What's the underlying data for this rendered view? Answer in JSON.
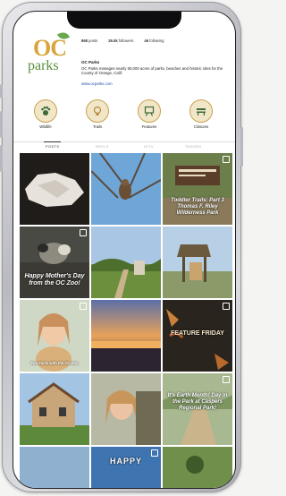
{
  "profile": {
    "logo_oc": "OC",
    "logo_parks": "parks",
    "posts_count": "868",
    "posts_label": "posts",
    "followers_count": "26.5k",
    "followers_label": "followers",
    "following_count": "46",
    "following_label": "following",
    "name": "OC Parks",
    "bio": "OC Parks manages nearly 60,000 acres of parks, beaches and historic sites for the County of Orange, Calif.",
    "link": "www.ocparks.com"
  },
  "highlights": [
    {
      "label": "Wildlife",
      "icon": "paw-icon"
    },
    {
      "label": "Trails",
      "icon": "bulb-icon"
    },
    {
      "label": "Features",
      "icon": "easel-icon"
    },
    {
      "label": "Closures",
      "icon": "bench-icon"
    }
  ],
  "tabs": [
    {
      "label": "POSTS",
      "active": true
    },
    {
      "label": "REELS",
      "active": false
    },
    {
      "label": "IGTV",
      "active": false
    },
    {
      "label": "TAGGED",
      "active": false
    }
  ],
  "posts": [
    {
      "overlay": ""
    },
    {
      "overlay": ""
    },
    {
      "overlay": "Toddler Trails: Part 3 Thomas F. Riley Wilderness Park"
    },
    {
      "overlay": "Happy Mother's Day from the OC Zoo!"
    },
    {
      "overlay": ""
    },
    {
      "overlay": ""
    },
    {
      "overlay": "Fun Facts with the OC Zoo"
    },
    {
      "overlay": ""
    },
    {
      "overlay": "FEATURE FRIDAY"
    },
    {
      "overlay": ""
    },
    {
      "overlay": ""
    },
    {
      "overlay": "It's Earth Month! Day in the Park at Caspers Regional Park!"
    },
    {
      "overlay": ""
    },
    {
      "overlay": "HAPPY"
    },
    {
      "overlay": ""
    }
  ],
  "colors": {
    "accent_gold": "#d9a43b",
    "accent_green": "#5a8f3d",
    "link_blue": "#1d4ea8"
  }
}
